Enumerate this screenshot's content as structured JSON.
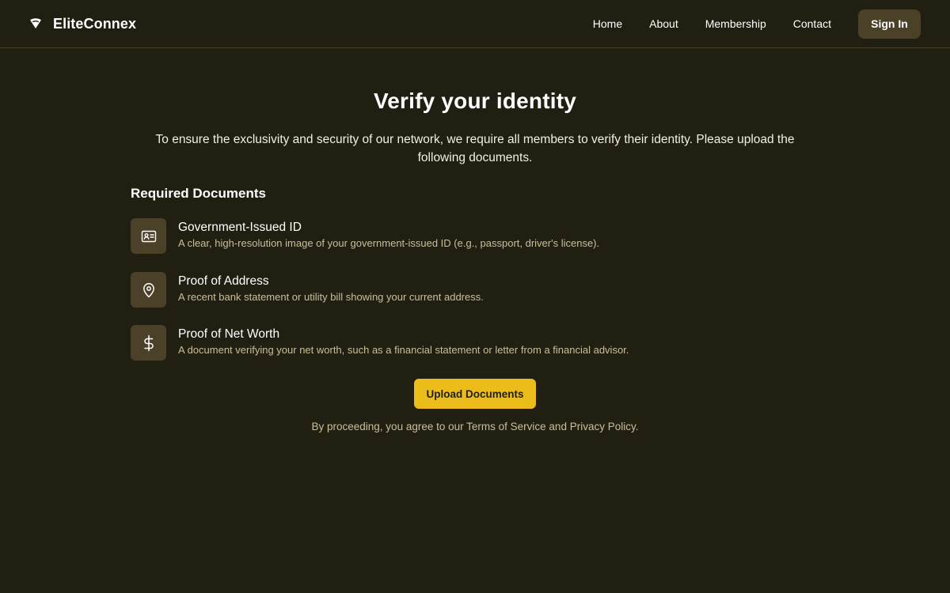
{
  "header": {
    "brand": "EliteConnex",
    "brand_icon": "wifi-logo-icon",
    "nav": [
      "Home",
      "About",
      "Membership",
      "Contact"
    ],
    "sign_in": "Sign In"
  },
  "main": {
    "title": "Verify your identity",
    "intro": "To ensure the exclusivity and security of our network, we require all members to verify their identity. Please upload the following documents.",
    "section_title": "Required Documents",
    "documents": [
      {
        "title": "Government-Issued ID",
        "description": "A clear, high-resolution image of your government-issued ID (e.g., passport, driver's license).",
        "icon": "id-card-icon"
      },
      {
        "title": "Proof of Address",
        "description": "A recent bank statement or utility bill showing your current address.",
        "icon": "map-pin-icon"
      },
      {
        "title": "Proof of Net Worth",
        "description": "A document verifying your net worth, such as a financial statement or letter from a financial advisor.",
        "icon": "dollar-icon"
      }
    ],
    "upload_label": "Upload Documents",
    "terms": {
      "prefix": "By proceeding, you agree to our ",
      "terms_link": "Terms of Service",
      "middle": " and ",
      "privacy_link": "Privacy Policy",
      "suffix": "."
    }
  },
  "colors": {
    "background": "#211f12",
    "accent": "#ecbc1b",
    "icon_tile": "#4a4128",
    "muted_text": "#c9bf9a"
  }
}
